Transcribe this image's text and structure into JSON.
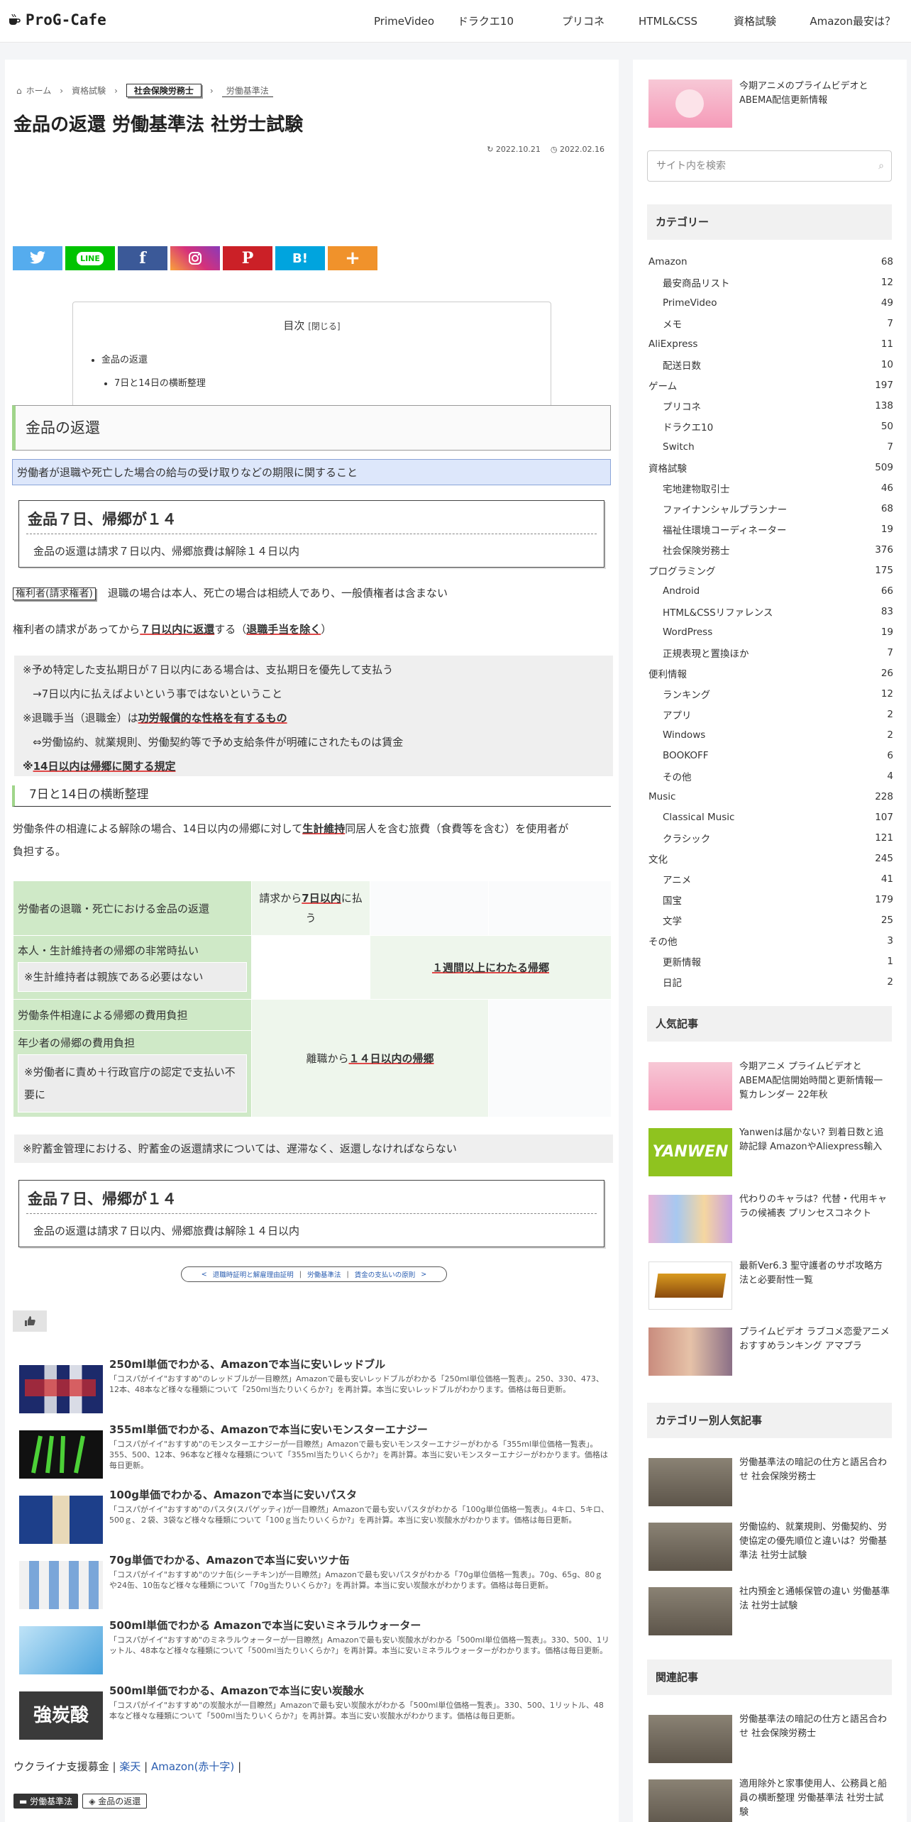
{
  "site": {
    "logo": "ProG-Cafe"
  },
  "nav": [
    "PrimeVideo",
    "ドラクエ10",
    "プリコネ",
    "HTML&CSS",
    "資格試験",
    "Amazon最安は？"
  ],
  "breadcrumb": {
    "home": "ホーム",
    "c1": "資格試験",
    "c2": "社会保険労務士",
    "c3": "労働基準法"
  },
  "article": {
    "title": "金品の返還 労働基準法 社労士試験",
    "updated": "2022.10.21",
    "published": "2022.02.16"
  },
  "share": [
    "t",
    "LINE",
    "f",
    "◎",
    "P",
    "B!",
    "+"
  ],
  "toc": {
    "title": "目次",
    "toggle": "[閉じる]",
    "item1": "金品の返還",
    "item2": "7日と14日の横断整理"
  },
  "sec1": {
    "h2": "金品の返還",
    "note": "労働者が退職や死亡した場合の給与の受け取りなどの期限に関すること",
    "box_title": "金品７日、帰郷が１４",
    "box_body": "金品の返還は請求７日以内、帰郷旅費は解除１４日以内",
    "kenri_tag": "権利者(請求権者)",
    "kenri_text": "退職の場合は本人、死亡の場合は相続人であり、一般債権者は含まない",
    "req_a": "権利者の請求があってから",
    "req_b": "７日以内に返還",
    "req_c": "する（",
    "req_d": "退職手当を除く",
    "req_e": "）",
    "g1": "※予め特定した支払期日が７日以内にある場合は、支払期日を優先して支払う",
    "g2": "→7日以内に払えばよいという事ではないということ",
    "g3a": "※退職手当（退職金）は",
    "g3b": "功労報償的な性格を有するもの",
    "g4": "⇔労働協約、就業規則、労働契約等で予め支給条件が明確にされたものは賃金",
    "g5a": "※",
    "g5b": "14日以内は帰郷に関する規定"
  },
  "sec2": {
    "h3": "7日と14日の横断整理",
    "p1a": "労働条件の相違による解除の場合、14日以内の帰郷に対して",
    "p1b": "生計維持",
    "p1c": "同居人を含む旅費（食費等を含む）を使用者が",
    "p2": "負担する。",
    "r1": "労働者の退職・死亡における金品の返還",
    "r1c2a": "請求から",
    "r1c2b": "7日以内",
    "r1c2c": "に払う",
    "r2": "本人・生計維持者の帰郷の非常時払い",
    "r2n": "※生計維持者は親族である必要はない",
    "r2c": "１週間以上にわたる帰郷",
    "r3": "労働条件相違による帰郷の費用負担",
    "r4": "年少者の帰郷の費用負担",
    "r4n": "※労働者に責め＋行政官庁の認定で支払い不要に",
    "r34c": "離職から",
    "r34cu": "１４日以内の帰郷",
    "g6": "※貯蓄金管理における、貯蓄金の返還請求については、遅滞なく、返還しなければならない",
    "box_title": "金品７日、帰郷が１４",
    "box_body": "金品の返還は請求７日以内、帰郷旅費は解除１４日以内"
  },
  "pager": {
    "prev": "<",
    "a": "退職時証明と解雇理由証明",
    "b": "労働基準法",
    "c": "賃金の支払いの原則",
    "next": ">"
  },
  "cards": [
    {
      "title": "250ml単価でわかる、Amazonで本当に安いレッドブル",
      "desc": "「コスパがイイ\"おすすめ\"のレッドブルが一目瞭然」Amazonで最も安いレッドブルがわかる「250ml単位価格一覧表」。250、330、473、12本、48本など様々な種類について「250ml当たりいくらか?」を再計算。本当に安いレッドブルがわかります。価格は毎日更新。"
    },
    {
      "title": "355ml単価でわかる、Amazonで本当に安いモンスターエナジー",
      "desc": "「コスパがイイ\"おすすめ\"のモンスターエナジーが一目瞭然」Amazonで最も安いモンスターエナジーがわかる「355ml単位価格一覧表」。355、500、12本、96本など様々な種類について「355ml当たりいくらか?」を再計算。本当に安いモンスターエナジーがわかります。価格は毎日更新。"
    },
    {
      "title": "100g単価でわかる、Amazonで本当に安いパスタ",
      "desc": "「コスパがイイ\"おすすめ\"のパスタ(スパゲッティ)が一目瞭然」Amazonで最も安いパスタがわかる「100g単位価格一覧表」。4キロ、5キロ、500ｇ、２袋、3袋など様々な種類について「100ｇ当たりいくらか?」を再計算。本当に安い炭酸水がわかります。価格は毎日更新。"
    },
    {
      "title": "70g単価でわかる、Amazonで本当に安いツナ缶",
      "desc": "「コスパがイイ\"おすすめ\"のツナ缶(シーチキン)が一目瞭然」Amazonで最も安いパスタがわかる「70g単位価格一覧表」。70g、65g、80ｇや24缶、10缶など様々な種類について「70g当たりいくらか?」を再計算。本当に安い炭酸水がわかります。価格は毎日更新。"
    },
    {
      "title": "500ml単価でわかる Amazonで本当に安いミネラルウォーター",
      "desc": "「コスパがイイ\"おすすめ\"のミネラルウォーターが一目瞭然」Amazonで最も安い炭酸水がわかる「500ml単位価格一覧表」。330、500、1リットル、48本など様々な種類について「500ml当たりいくらか?」を再計算。本当に安いミネラルウォーターがわかります。価格は毎日更新。"
    },
    {
      "title": "500ml単価でわかる、Amazonで本当に安い炭酸水",
      "desc": "「コスパがイイ\"おすすめ\"の炭酸水が一目瞭然」Amazonで最も安い炭酸水がわかる「500ml単位価格一覧表」。330、500、1リットル、48本など様々な種類について「500ml当たりいくらか?」を再計算。本当に安い炭酸水がわかります。価格は毎日更新。"
    }
  ],
  "card_thumb_text": {
    "c6": "強炭酸"
  },
  "support": {
    "a": "ウクライナ支援募金 |",
    "b": "楽天",
    "c": "|",
    "d": "Amazon(赤十字)",
    "e": "|"
  },
  "tags": [
    "労働基準法",
    "金品の返還"
  ],
  "sidebar": {
    "top_post": "今期アニメのプライムビデオとABEMA配信更新情報",
    "search_placeholder": "サイト内を検索",
    "cat_head": "カテゴリー",
    "categories": [
      [
        "Amazon",
        "68",
        0
      ],
      [
        "最安商品リスト",
        "12",
        1
      ],
      [
        "PrimeVideo",
        "49",
        1
      ],
      [
        "メモ",
        "7",
        1
      ],
      [
        "AliExpress",
        "11",
        0
      ],
      [
        "配送日数",
        "10",
        1
      ],
      [
        "ゲーム",
        "197",
        0
      ],
      [
        "プリコネ",
        "138",
        1
      ],
      [
        "ドラクエ10",
        "50",
        1
      ],
      [
        "Switch",
        "7",
        1
      ],
      [
        "資格試験",
        "509",
        0
      ],
      [
        "宅地建物取引士",
        "46",
        1
      ],
      [
        "ファイナンシャルプランナー",
        "68",
        1
      ],
      [
        "福祉住環境コーディネーター",
        "19",
        1
      ],
      [
        "社会保険労務士",
        "376",
        1
      ],
      [
        "プログラミング",
        "175",
        0
      ],
      [
        "Android",
        "66",
        1
      ],
      [
        "HTML&CSSリファレンス",
        "83",
        1
      ],
      [
        "WordPress",
        "19",
        1
      ],
      [
        "正規表現と置換ほか",
        "7",
        1
      ],
      [
        "便利情報",
        "26",
        0
      ],
      [
        "ランキング",
        "12",
        1
      ],
      [
        "アプリ",
        "2",
        1
      ],
      [
        "Windows",
        "2",
        1
      ],
      [
        "BOOKOFF",
        "6",
        1
      ],
      [
        "その他",
        "4",
        1
      ],
      [
        "Music",
        "228",
        0
      ],
      [
        "Classical Music",
        "107",
        1
      ],
      [
        "クラシック",
        "121",
        1
      ],
      [
        "文化",
        "245",
        0
      ],
      [
        "アニメ",
        "41",
        1
      ],
      [
        "国宝",
        "179",
        1
      ],
      [
        "文学",
        "25",
        1
      ],
      [
        "その他",
        "3",
        0
      ],
      [
        "更新情報",
        "1",
        1
      ],
      [
        "日記",
        "2",
        1
      ]
    ],
    "popular_head": "人気記事",
    "popular": [
      "今期アニメ プライムビデオとABEMA配信開始時間と更新情報一覧カレンダー 22年秋",
      "Yanwenは届かない? 到着日数と追跡記録 AmazonやAliexpress輸入",
      "代わりのキャラは？代替・代用キャラの候補表 プリンセスコネクト",
      "最新Ver6.3 聖守護者のサポ攻略方法と必要耐性一覧",
      "プライムビデオ ラブコメ恋愛アニメおすすめランキング アマプラ"
    ],
    "yanwen_logo": "YANWEN",
    "catpop_head": "カテゴリー別人気記事",
    "catpop": [
      "労働基準法の暗記の仕方と語呂合わせ 社会保険労務士",
      "労働協約、就業規則、労働契約、労使協定の優先順位と違いは？労働基準法 社労士試験",
      "社内預金と通帳保管の違い 労働基準法 社労士試験"
    ],
    "related_head": "関連記事",
    "related": [
      "労働基準法の暗記の仕方と語呂合わせ 社会保険労務士",
      "適用除外と家事使用人、公務員と船員の横断整理 労働基準法 社労士試験"
    ]
  },
  "colors": {
    "twitter": "#55acee",
    "line": "#00c300",
    "facebook": "#3b5998",
    "instagram": "#d6317a",
    "pinterest": "#cb2027",
    "hatena": "#00a4de",
    "more": "#f0922b",
    "accent_green": "#a0d58a"
  }
}
